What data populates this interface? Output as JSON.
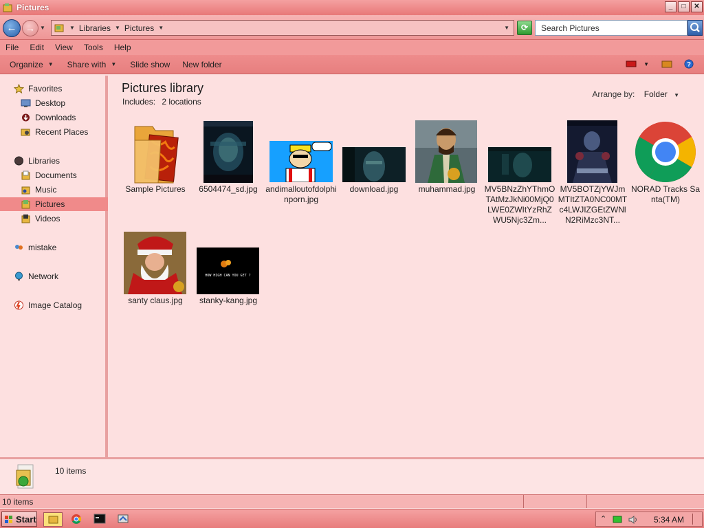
{
  "window": {
    "title": "Pictures"
  },
  "address": {
    "crumbs": [
      "Libraries",
      "Pictures"
    ],
    "search_placeholder": "Search Pictures"
  },
  "menu": [
    "File",
    "Edit",
    "View",
    "Tools",
    "Help"
  ],
  "toolbar": {
    "organize": "Organize",
    "share_with": "Share with",
    "slide_show": "Slide show",
    "new_folder": "New folder"
  },
  "sidebar": {
    "favorites": "Favorites",
    "desktop": "Desktop",
    "downloads": "Downloads",
    "recent_places": "Recent Places",
    "libraries": "Libraries",
    "documents": "Documents",
    "music": "Music",
    "pictures": "Pictures",
    "videos": "Videos",
    "mistake": "mistake",
    "network": "Network",
    "image_catalog": "Image Catalog"
  },
  "main": {
    "title": "Pictures library",
    "includes_label": "Includes:",
    "includes_value": "2 locations",
    "arrange_label": "Arrange by:",
    "arrange_value": "Folder"
  },
  "files": [
    "Sample Pictures",
    "6504474_sd.jpg",
    "andimalloutofdolphinporn.jpg",
    "download.jpg",
    "muhammad.jpg",
    "MV5BNzZhYThmOTAtMzJkNi00MjQ0LWE0ZWItYzRhZWU5Njc3Zm...",
    "MV5BOTZjYWJmMTItZTA0NC00MTc4LWJIZGEtZWNlN2RiMzc3NT...",
    "NORAD Tracks Santa(TM)",
    "santy claus.jpg",
    "stanky-kang.jpg"
  ],
  "thumb_texts": {
    "stanky": "HOW HIGH CAN YOU GET ?"
  },
  "details": {
    "count": "10 items"
  },
  "status": {
    "items": "10 items"
  },
  "taskbar": {
    "start": "Start",
    "clock": "5:34 AM"
  },
  "colors": {
    "chrome": "#f29a9a",
    "background": "#fde0e0",
    "selected": "#f08a8a"
  }
}
